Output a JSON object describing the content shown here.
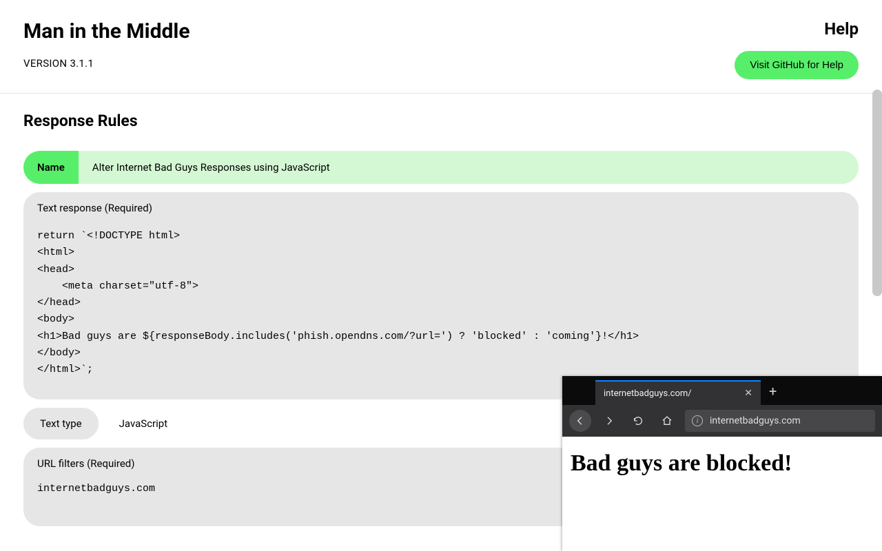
{
  "header": {
    "title": "Man in the Middle",
    "version": "VERSION 3.1.1",
    "help_label": "Help",
    "help_button": "Visit GitHub for Help"
  },
  "section_title": "Response Rules",
  "rule": {
    "name_chip": "Name",
    "name_value": "Alter Internet Bad Guys Responses using JavaScript",
    "text_response_label": "Text response (Required)",
    "text_response_code": "return `<!DOCTYPE html>\n<html>\n<head>\n    <meta charset=\"utf-8\">\n</head>\n<body>\n<h1>Bad guys are ${responseBody.includes('phish.opendns.com/?url=') ? 'blocked' : 'coming'}!</h1>\n</body>\n</html>`;",
    "text_type_chip": "Text type",
    "text_type_value": "JavaScript",
    "url_filters_label": "URL filters (Required)",
    "url_filters_value": "internetbadguys.com"
  },
  "browser": {
    "tab_title": "internetbadguys.com/",
    "url": "internetbadguys.com",
    "page_heading": "Bad guys are blocked!"
  }
}
